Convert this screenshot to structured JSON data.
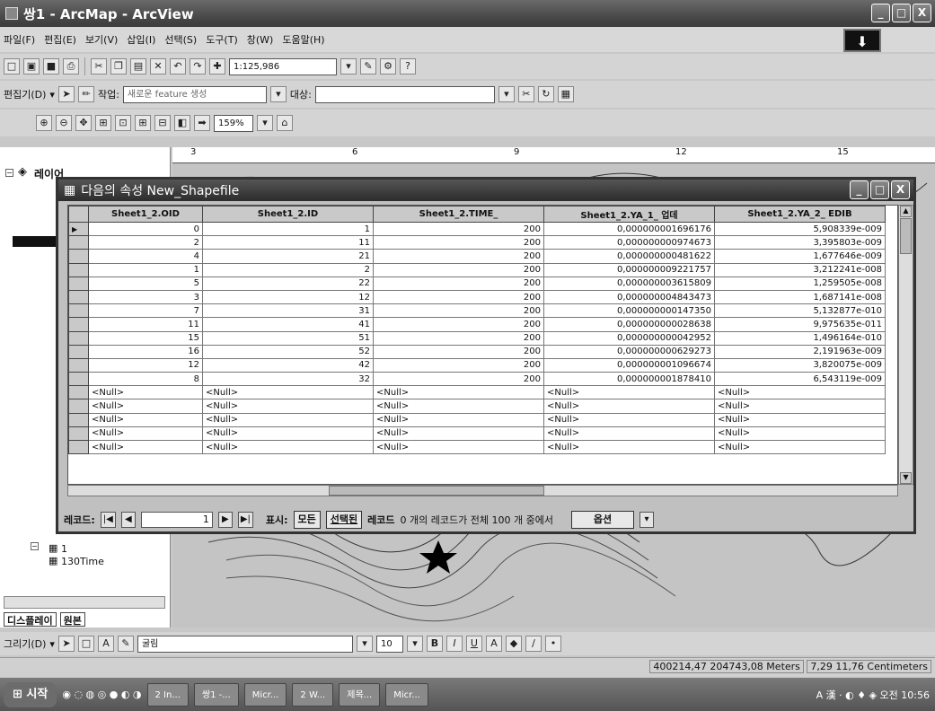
{
  "window": {
    "title": "쌍1 - ArcMap - ArcView",
    "minimize": "_",
    "maximize": "□",
    "close": "X"
  },
  "menubar": [
    "파일(F)",
    "편집(E)",
    "보기(V)",
    "삽입(I)",
    "선택(S)",
    "도구(T)",
    "창(W)",
    "도움말(H)"
  ],
  "toolbar1": {
    "icons": [
      "new-icon",
      "open-icon",
      "save-icon",
      "print-icon",
      "cut-icon",
      "copy-icon",
      "paste-icon",
      "delete-icon",
      "undo-icon",
      "redo-icon",
      "add-data-icon"
    ],
    "scale": "1:125,986",
    "extra_icons": [
      "editor-icon",
      "arc-toolbox-icon",
      "help-icon"
    ]
  },
  "editor_toolbar": {
    "label": "편집기(D)",
    "task_label": "작업:",
    "task_value": "새로운 feature 생성",
    "target_label": "대상:",
    "target_value": ""
  },
  "toolbar3": {
    "zoom": "159%"
  },
  "toc": {
    "root": "레이어",
    "items": [
      "1",
      "130Time"
    ],
    "tabs": [
      "디스플레이",
      "원본"
    ]
  },
  "ruler": [
    "3",
    "6",
    "9",
    "12",
    "15"
  ],
  "dialog": {
    "title": "다음의 속성 New_Shapefile",
    "columns": [
      "Sheet1_2.OID",
      "Sheet1_2.ID",
      "Sheet1_2.TIME_",
      "Sheet1_2.YA_1_ 업데",
      "Sheet1_2.YA_2_ EDIB"
    ],
    "rows": [
      [
        "0",
        "1",
        "200",
        "0,000000001696176",
        "5,908339e-009"
      ],
      [
        "2",
        "11",
        "200",
        "0,000000000974673",
        "3,395803e-009"
      ],
      [
        "4",
        "21",
        "200",
        "0,000000000481622",
        "1,677646e-009"
      ],
      [
        "1",
        "2",
        "200",
        "0,000000009221757",
        "3,212241e-008"
      ],
      [
        "5",
        "22",
        "200",
        "0,000000003615809",
        "1,259505e-008"
      ],
      [
        "3",
        "12",
        "200",
        "0,000000004843473",
        "1,687141e-008"
      ],
      [
        "7",
        "31",
        "200",
        "0,000000000147350",
        "5,132877e-010"
      ],
      [
        "11",
        "41",
        "200",
        "0,000000000028638",
        "9,975635e-011"
      ],
      [
        "15",
        "51",
        "200",
        "0,000000000042952",
        "1,496164e-010"
      ],
      [
        "16",
        "52",
        "200",
        "0,000000000629273",
        "2,191963e-009"
      ],
      [
        "12",
        "42",
        "200",
        "0,000000001096674",
        "3,820075e-009"
      ],
      [
        "8",
        "32",
        "200",
        "0,000000001878410",
        "6,543119e-009"
      ],
      [
        "<Null>",
        "<Null>",
        "<Null>",
        "<Null>",
        "<Null>"
      ],
      [
        "<Null>",
        "<Null>",
        "<Null>",
        "<Null>",
        "<Null>"
      ],
      [
        "<Null>",
        "<Null>",
        "<Null>",
        "<Null>",
        "<Null>"
      ],
      [
        "<Null>",
        "<Null>",
        "<Null>",
        "<Null>",
        "<Null>"
      ],
      [
        "<Null>",
        "<Null>",
        "<Null>",
        "<Null>",
        "<Null>"
      ]
    ],
    "nav": {
      "record_label": "레코드:",
      "first": "|◀",
      "prev": "◀",
      "current": "1",
      "next": "▶",
      "last": "▶|",
      "show_label": "표시:",
      "all_btn": "모든",
      "selected_btn": "선택된",
      "records_label": "레코드",
      "summary": "0 개의 레코드가 전체 100 개 중에서",
      "options": "옵션"
    }
  },
  "drawing_toolbar": {
    "label": "그리기(D)",
    "font": "굴림",
    "size": "10",
    "bold": "B",
    "italic": "I",
    "underline": "U",
    "font_color": "A"
  },
  "status": {
    "coords": "400214,47  204743,08 Meters",
    "page_coords": "7,29  11,76 Centimeters"
  },
  "taskbar": {
    "start": "시작",
    "buttons": [
      "2 In...",
      "쌍1 -...",
      "Micr...",
      "2 W...",
      "제목...",
      "Micr..."
    ],
    "tray": "A 漢 ·  ◐ ♦ ◈  오전 10:56"
  }
}
